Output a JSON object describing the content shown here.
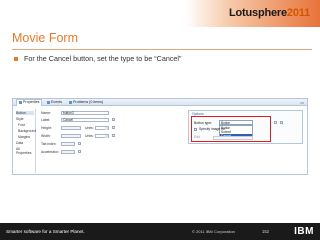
{
  "header": {
    "brand": "Lotusphere",
    "brand_year": "2011"
  },
  "slide": {
    "title": "Movie Form",
    "bullet": "For the Cancel button, set the type to be “Cancel”"
  },
  "screenshot": {
    "tabs": [
      {
        "label": "Properties"
      },
      {
        "label": "Events"
      },
      {
        "label": "Problems (0 items)"
      }
    ],
    "sidebar": [
      "Button",
      "Style",
      "Font",
      "Background",
      "Margins",
      "Data",
      "All Properties"
    ],
    "fields": {
      "name_label": "Name:",
      "name_value": "button3",
      "label_label": "Label:",
      "label_value": "Cancel",
      "height_label": "Height:",
      "width_label": "Width:",
      "units_label": "Units:",
      "units_label2": "Units:",
      "tab_index_label": "Tab index:",
      "accelerator_label": "Accelerator:"
    },
    "options": {
      "section_title": "Options",
      "button_type_label": "Button type:",
      "button_type_value": "Button",
      "button_type_options": [
        "Button",
        "Submit",
        "Cancel"
      ],
      "selected_option": "Cancel",
      "specify_image_label": "Specify image for",
      "edit_label": "Edit"
    }
  },
  "footer": {
    "tagline": "Smarter software for a Smarter Planet.",
    "copyright": "© 2011 IBM Corporation",
    "page": "152",
    "logo": "IBM"
  },
  "colors": {
    "accent": "#e77a2b",
    "highlight_box": "#e21b1b",
    "footer_bg": "#1a1a1a"
  }
}
